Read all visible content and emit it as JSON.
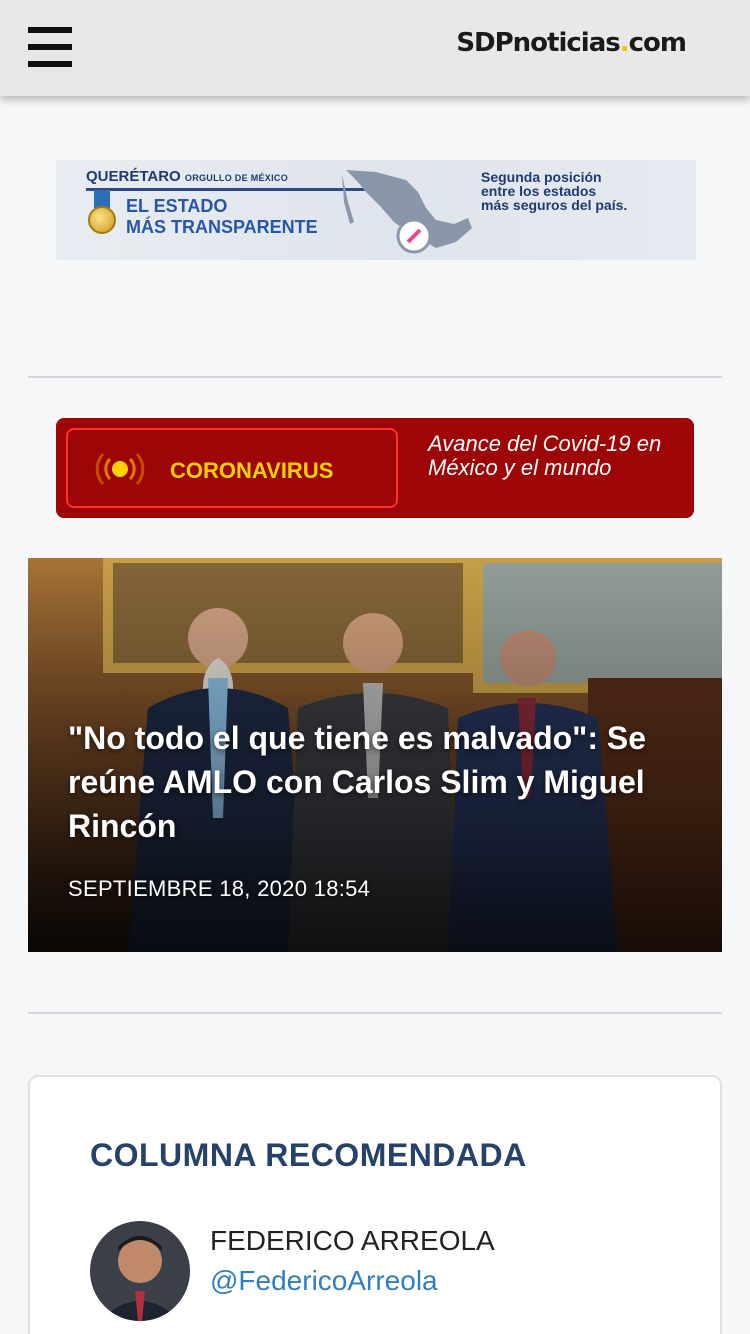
{
  "header": {
    "logo_main": "SDPnoticias",
    "logo_dot": ".",
    "logo_tld": "com"
  },
  "ad": {
    "state": "QUERÉTARO",
    "state_tagline": "ORGULLO DE MÉXICO",
    "title_line1": "EL ESTADO",
    "title_line2": "MÁS TRANSPARENTE",
    "right_line1": "Segunda posición",
    "right_line2": "entre los estados",
    "right_line3": "más seguros del país."
  },
  "corona": {
    "label": "CORONAVIRUS",
    "description": "Avance del Covid-19 en México y el mundo",
    "colors": {
      "background": "#9e0506",
      "label": "#ffd200",
      "border": "#ff3030"
    }
  },
  "hero": {
    "title": "\"No todo el que tiene es malvado\": Se reúne AMLO con Carlos Slim y Miguel Rincón",
    "date": "SEPTIEMBRE 18, 2020 18:54"
  },
  "column": {
    "heading": "COLUMNA RECOMENDADA",
    "author_name": "FEDERICO ARREOLA",
    "author_handle": "@FedericoArreola",
    "colors": {
      "heading": "#26426b",
      "handle": "#2f7fbf"
    }
  }
}
